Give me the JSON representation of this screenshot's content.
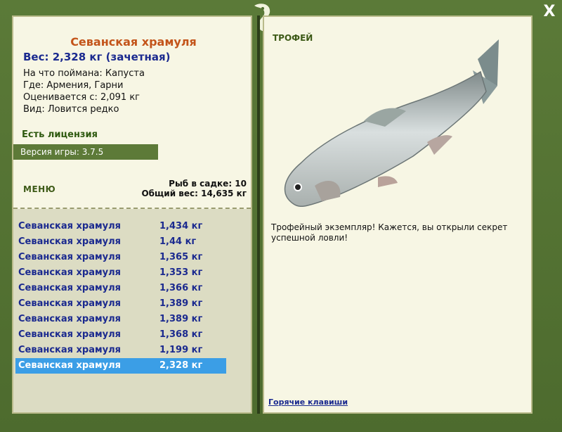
{
  "close_label": "X",
  "fish": {
    "name": "Севанская храмуля",
    "weight_line": "Вес: 2,328 кг (зачетная)",
    "caught_on": "На что поймана: Капуста",
    "location": "Где: Армения, Гарни",
    "valued_from": "Оценивается с: 2,091 кг",
    "type": "Вид: Ловится редко"
  },
  "license": "Есть лицензия",
  "version": "Версия игры: 3.7.5",
  "menu_label": "МЕНЮ",
  "stats": {
    "fish_count": "Рыб в садке: 10",
    "total_weight": "Общий вес: 14,635 кг"
  },
  "catch_list": [
    {
      "name": "Севанская храмуля",
      "weight": "1,434 кг"
    },
    {
      "name": "Севанская храмуля",
      "weight": "1,44 кг"
    },
    {
      "name": "Севанская храмуля",
      "weight": "1,365 кг"
    },
    {
      "name": "Севанская храмуля",
      "weight": "1,353 кг"
    },
    {
      "name": "Севанская храмуля",
      "weight": "1,366 кг"
    },
    {
      "name": "Севанская храмуля",
      "weight": "1,389 кг"
    },
    {
      "name": "Севанская храмуля",
      "weight": "1,389 кг"
    },
    {
      "name": "Севанская храмуля",
      "weight": "1,368 кг"
    },
    {
      "name": "Севанская храмуля",
      "weight": "1,199 кг"
    },
    {
      "name": "Севанская храмуля",
      "weight": "2,328 кг"
    }
  ],
  "selected_index": 9,
  "trophy_label": "ТРОФЕЙ",
  "trophy_text": "Трофейный экземпляр! Кажется, вы открыли секрет успешной ловли!",
  "hotkeys_label": "Горячие клавиши",
  "colors": {
    "frame": "#4f6e30",
    "panel": "#f7f6e4",
    "selected": "#3b9ee6",
    "title": "#c3541a",
    "link": "#1b2a8f"
  },
  "icons": {
    "close": "close-icon",
    "logo": "seahorse-logo-icon"
  }
}
